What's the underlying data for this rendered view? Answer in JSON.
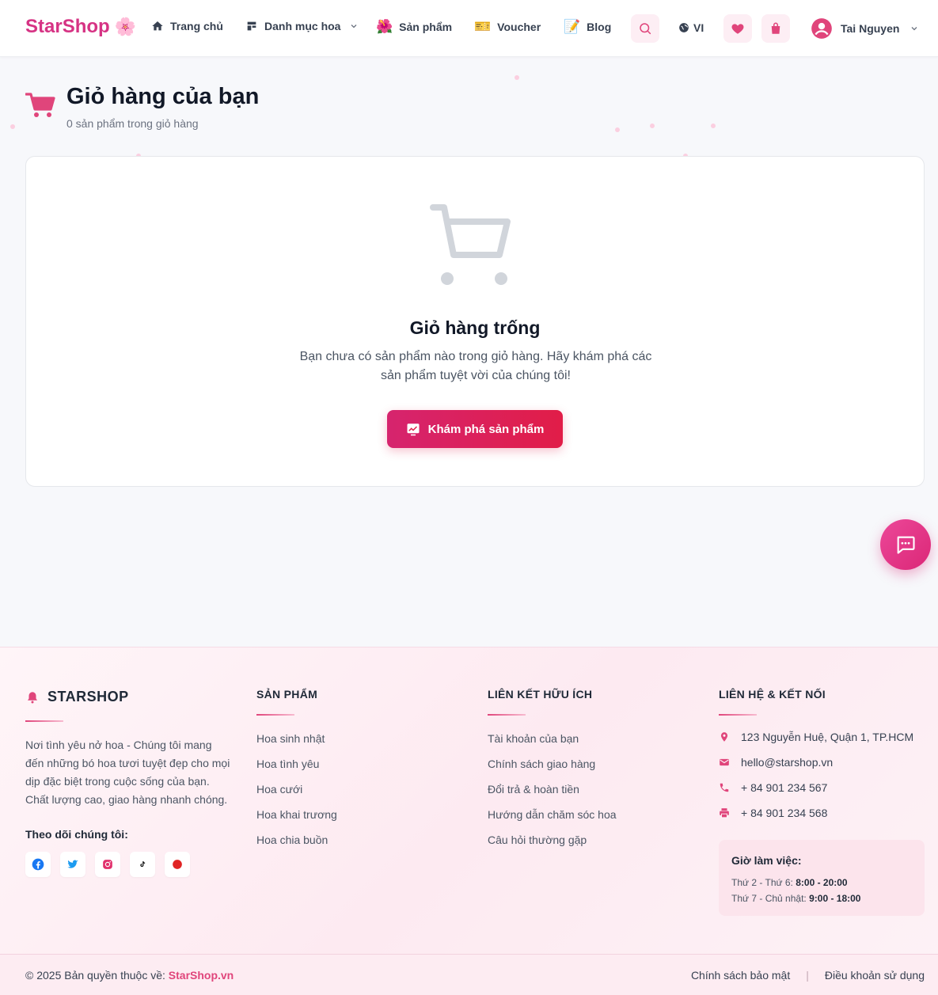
{
  "header": {
    "logo_text": "StarShop",
    "logo_emoji": "🌸",
    "nav": [
      {
        "label": "Trang chủ",
        "icon": "home-icon"
      },
      {
        "label": "Danh mục hoa",
        "icon": "category-icon",
        "has_dropdown": true
      },
      {
        "label": "Sản phẩm",
        "icon": "hibiscus-emoji",
        "emoji": "🌺"
      },
      {
        "label": "Voucher",
        "icon": "ticket-emoji",
        "emoji": "🎫"
      },
      {
        "label": "Blog",
        "icon": "memo-emoji",
        "emoji": "📝"
      }
    ],
    "language": "VI",
    "user_name": "Tai Nguyen"
  },
  "cart": {
    "title": "Giỏ hàng của bạn",
    "subtitle": "0 sản phẩm trong giỏ hàng",
    "empty_title": "Giỏ hàng trống",
    "empty_description": "Bạn chưa có sản phẩm nào trong giỏ hàng. Hãy khám phá các sản phẩm tuyệt vời của chúng tôi!",
    "explore_button": "Khám phá sản phẩm"
  },
  "footer": {
    "brand": "STARSHOP",
    "description": "Nơi tình yêu nở hoa - Chúng tôi mang đến những bó hoa tươi tuyệt đẹp cho mọi dịp đặc biệt trong cuộc sống của bạn. Chất lượng cao, giao hàng nhanh chóng.",
    "follow_label": "Theo dõi chúng tôi:",
    "socials": [
      "facebook-icon",
      "twitter-icon",
      "instagram-icon",
      "tiktok-icon",
      "youtube-icon"
    ],
    "products": {
      "heading": "SẢN PHẨM",
      "links": [
        "Hoa sinh nhật",
        "Hoa tình yêu",
        "Hoa cưới",
        "Hoa khai trương",
        "Hoa chia buồn"
      ]
    },
    "useful": {
      "heading": "LIÊN KẾT HỮU ÍCH",
      "links": [
        "Tài khoản của bạn",
        "Chính sách giao hàng",
        "Đổi trả & hoàn tiền",
        "Hướng dẫn chăm sóc hoa",
        "Câu hỏi thường gặp"
      ]
    },
    "contact": {
      "heading": "LIÊN HỆ & KẾT NỐI",
      "address": "123 Nguyễn Huệ, Quận 1, TP.HCM",
      "email": "hello@starshop.vn",
      "phone": "+ 84 901 234 567",
      "fax": "+ 84 901 234 568"
    },
    "hours": {
      "title": "Giờ làm việc:",
      "weekday_label": "Thứ 2 - Thứ 6: ",
      "weekday_time": "8:00 - 20:00",
      "weekend_label": "Thứ 7 - Chủ nhật: ",
      "weekend_time": "9:00 - 18:00"
    },
    "copyright_prefix": "© 2025 Bản quyền thuộc về: ",
    "copyright_brand": "StarShop.vn",
    "privacy": "Chính sách bảo mật",
    "separator": "|",
    "terms": "Điều khoản sử dụng"
  },
  "colors": {
    "brand": "#d63384",
    "accent": "#e11d48",
    "empty_icon": "#d1d5db"
  }
}
